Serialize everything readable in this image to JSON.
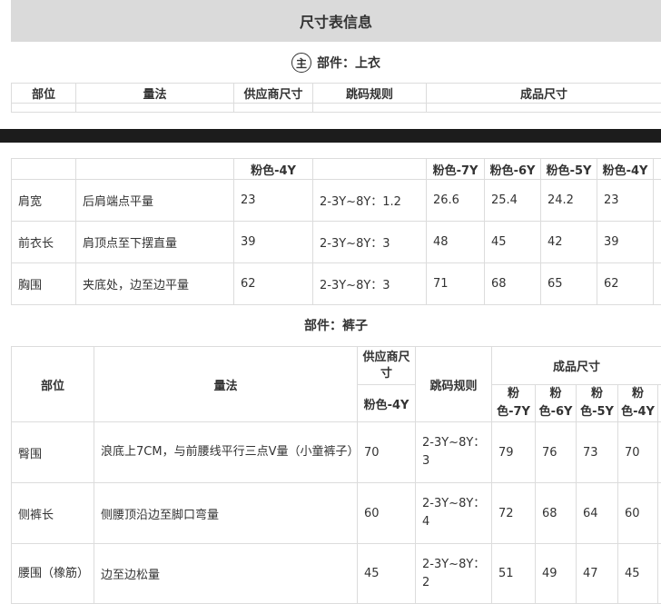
{
  "title": "尺寸表信息",
  "top": {
    "icon": "主",
    "section_label": "部件：上衣",
    "headers": {
      "part": "部位",
      "method": "量法",
      "supplier": "供应商尺寸",
      "rule": "跳码规则",
      "finished": "成品尺寸"
    }
  },
  "top_table": {
    "supplier_col": "粉色-4Y",
    "finished_cols": [
      "粉色-7Y",
      "粉色-6Y",
      "粉色-5Y",
      "粉色-4Y"
    ],
    "rows": [
      {
        "part": "肩宽",
        "method": "后肩端点平量",
        "supplier": "23",
        "rule": "2-3Y~8Y：1.2",
        "values": [
          "26.6",
          "25.4",
          "24.2",
          "23"
        ]
      },
      {
        "part": "前衣长",
        "method": "肩顶点至下摆直量",
        "supplier": "39",
        "rule": "2-3Y~8Y：3",
        "values": [
          "48",
          "45",
          "42",
          "39"
        ]
      },
      {
        "part": "胸围",
        "method": "夹底处，边至边平量",
        "supplier": "62",
        "rule": "2-3Y~8Y：3",
        "values": [
          "71",
          "68",
          "65",
          "62"
        ]
      }
    ]
  },
  "bottom": {
    "section_label": "部件：裤子",
    "headers": {
      "part": "部位",
      "method": "量法",
      "supplier": "供应商尺寸",
      "rule": "跳码规则",
      "finished": "成品尺寸"
    },
    "supplier_col": "粉色-4Y",
    "finished_cols": [
      "粉色-7Y",
      "粉色-6Y",
      "粉色-5Y",
      "粉色-4Y"
    ],
    "rows": [
      {
        "part": "臀围",
        "method": "浪底上7CM，与前腰线平行三点V量（小童裤子）",
        "supplier": "70",
        "rule": "2-3Y~8Y：3",
        "values": [
          "79",
          "76",
          "73",
          "70"
        ]
      },
      {
        "part": "侧裤长",
        "method": "侧腰顶沿边至脚口弯量",
        "supplier": "60",
        "rule": "2-3Y~8Y：4",
        "values": [
          "72",
          "68",
          "64",
          "60"
        ]
      },
      {
        "part": "腰围（橡筋）",
        "method": "边至边松量",
        "supplier": "45",
        "rule": "2-3Y~8Y：2",
        "values": [
          "51",
          "49",
          "47",
          "45"
        ]
      }
    ]
  }
}
